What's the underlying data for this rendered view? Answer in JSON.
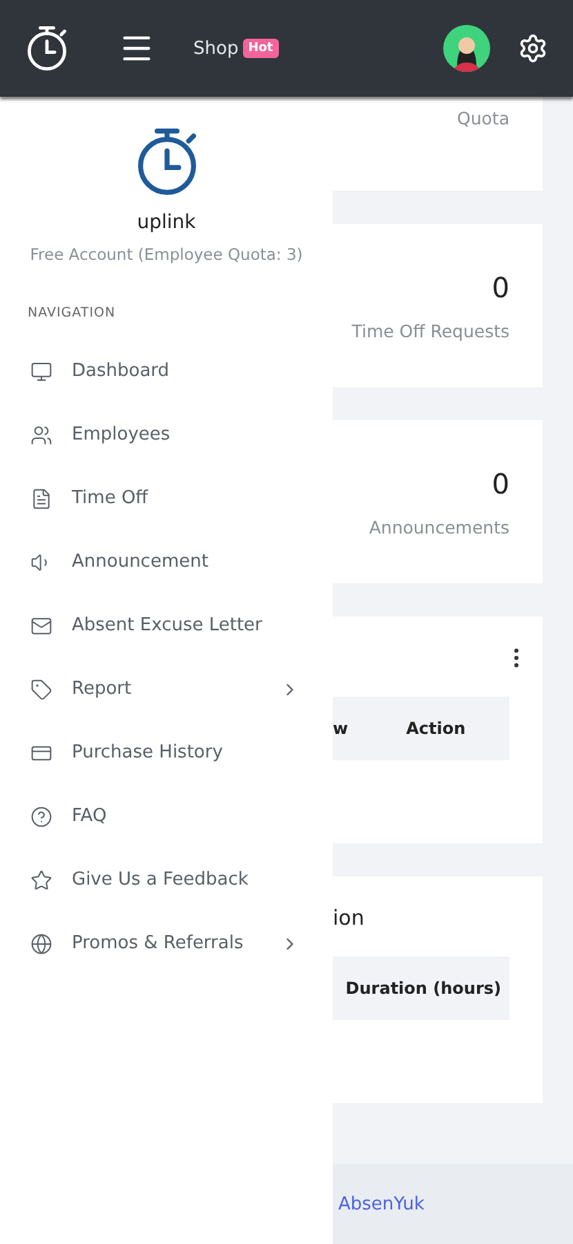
{
  "header": {
    "shop": "Shop",
    "shop_badge": "Hot"
  },
  "drawer": {
    "account_name": "uplink",
    "account_plan": "Free Account (Employee Quota: 3)",
    "section_title": "NAVIGATION",
    "items": [
      {
        "kind": "dashboard",
        "label": "Dashboard",
        "submenu": false
      },
      {
        "kind": "employees",
        "label": "Employees",
        "submenu": false
      },
      {
        "kind": "timeoff",
        "label": "Time Off",
        "submenu": false
      },
      {
        "kind": "announcement",
        "label": "Announcement",
        "submenu": false
      },
      {
        "kind": "letter",
        "label": "Absent Excuse Letter",
        "submenu": false
      },
      {
        "kind": "report",
        "label": "Report",
        "submenu": true
      },
      {
        "kind": "purchase",
        "label": "Purchase History",
        "submenu": false
      },
      {
        "kind": "faq",
        "label": "FAQ",
        "submenu": false
      },
      {
        "kind": "feedback",
        "label": "Give Us a Feedback",
        "submenu": false
      },
      {
        "kind": "promos",
        "label": "Promos & Referrals",
        "submenu": true
      }
    ]
  },
  "stats": [
    {
      "label": "Quota"
    },
    {
      "value": "0",
      "label": "Time Off Requests"
    },
    {
      "value": "0",
      "label": "Announcements"
    }
  ],
  "tables": [
    {
      "menu": true,
      "columns": [
        "w",
        "Action"
      ]
    },
    {
      "title": "ion",
      "menu": false,
      "columns": [
        "Duration (hours)"
      ]
    }
  ],
  "footer": {
    "link": "AbsenYuk"
  }
}
